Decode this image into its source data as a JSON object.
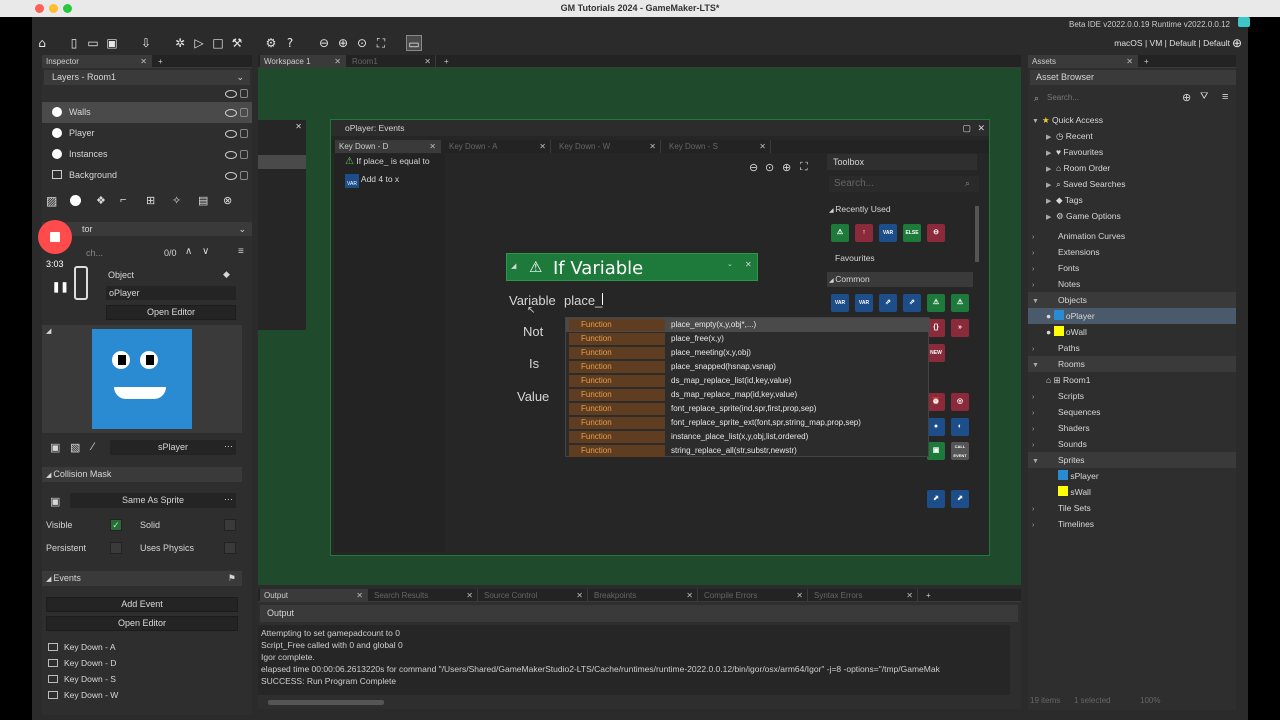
{
  "window": {
    "title": "GM Tutorials 2024 - GameMaker-LTS*"
  },
  "toolbar": {
    "version": "Beta IDE v2022.0.0.19  Runtime v2022.0.0.12",
    "target": "macOS | VM | Default | Default"
  },
  "inspector": {
    "tab": "Inspector",
    "layers_title": "Layers - Room1",
    "layers": [
      {
        "name": "Walls"
      },
      {
        "name": "Player"
      },
      {
        "name": "Instances"
      },
      {
        "name": "Background"
      }
    ],
    "editor_tab": "tor",
    "search_placeholder": "ch...",
    "count": "0/0",
    "object_label": "Object",
    "object_value": "oPlayer",
    "open_editor": "Open Editor",
    "sprite_name": "sPlayer",
    "collision_mask_title": "Collision Mask",
    "collision_mask_value": "Same As Sprite",
    "visible_label": "Visible",
    "solid_label": "Solid",
    "persistent_label": "Persistent",
    "physics_label": "Uses Physics",
    "events_title": "Events",
    "add_event": "Add Event",
    "open_editor2": "Open Editor",
    "events": [
      "Key Down - A",
      "Key Down - D",
      "Key Down - S",
      "Key Down - W"
    ]
  },
  "recorder": {
    "time": "3:03"
  },
  "workspace": {
    "tabs": [
      "Workspace 1",
      "Room1"
    ]
  },
  "events_window": {
    "title": "oPlayer: Events",
    "tabs": [
      "Key Down - D",
      "Key Down - A",
      "Key Down - W",
      "Key Down - S"
    ],
    "list": [
      {
        "text": "If place_ is equal to"
      },
      {
        "text": "Add 4 to x"
      }
    ],
    "var_badge": "VAR"
  },
  "if_variable": {
    "title": "If Variable",
    "variable_label": "Variable",
    "variable_value": "place_",
    "not_label": "Not",
    "is_label": "Is",
    "value_label": "Value"
  },
  "autocomplete": {
    "type": "Function",
    "items": [
      "place_empty(x,y,obj*,...)",
      "place_free(x,y)",
      "place_meeting(x,y,obj)",
      "place_snapped(hsnap,vsnap)",
      "ds_map_replace_list(id,key,value)",
      "ds_map_replace_map(id,key,value)",
      "font_replace_sprite(ind,spr,first,prop,sep)",
      "font_replace_sprite_ext(font,spr,string_map,prop,sep)",
      "instance_place_list(x,y,obj,list,ordered)",
      "string_replace_all(str,substr,newstr)"
    ]
  },
  "toolbox": {
    "title": "Toolbox",
    "search_placeholder": "Search...",
    "recently_used": "Recently Used",
    "favourites": "Favourites",
    "common": "Common",
    "else_label": "ELSE",
    "var_label": "VAR",
    "new_label": "NEW",
    "call_label": "CALL EVENT"
  },
  "output": {
    "tabs": [
      "Output",
      "Search Results",
      "Source Control",
      "Breakpoints",
      "Compile Errors",
      "Syntax Errors"
    ],
    "sub_title": "Output",
    "lines": [
      "Attempting to set gamepadcount to 0",
      "Script_Free called with 0 and global 0",
      "Igor complete.",
      "elapsed time 00:00:06.2613220s for command \"/Users/Shared/GameMakerStudio2-LTS/Cache/runtimes/runtime-2022.0.0.12/bin/igor/osx/arm64/Igor\" -j=8 -options=\"/tmp/GameMak",
      "SUCCESS: Run Program Complete"
    ]
  },
  "assets": {
    "tab": "Assets",
    "browser": "Asset Browser",
    "search_placeholder": "Search...",
    "quick_access": "Quick Access",
    "quick_items": [
      "Recent",
      "Favourites",
      "Room Order",
      "Saved Searches",
      "Tags",
      "Game Options"
    ],
    "folders": [
      {
        "name": "Animation Curves"
      },
      {
        "name": "Extensions"
      },
      {
        "name": "Fonts"
      },
      {
        "name": "Notes"
      },
      {
        "name": "Objects"
      },
      {
        "name": "oPlayer"
      },
      {
        "name": "oWall"
      },
      {
        "name": "Paths"
      },
      {
        "name": "Rooms"
      },
      {
        "name": "Room1"
      },
      {
        "name": "Scripts"
      },
      {
        "name": "Sequences"
      },
      {
        "name": "Shaders"
      },
      {
        "name": "Sounds"
      },
      {
        "name": "Sprites"
      },
      {
        "name": "sPlayer"
      },
      {
        "name": "sWall"
      },
      {
        "name": "Tile Sets"
      },
      {
        "name": "Timelines"
      }
    ],
    "footer_items": "19 items",
    "footer_selected": "1 selected",
    "footer_zoom": "100%"
  },
  "colors": {
    "accent_green": "#1e7a3a",
    "selection": "#4a5a6a",
    "player_blue": "#2a8ad2",
    "function_orange": "#e89c4a"
  }
}
